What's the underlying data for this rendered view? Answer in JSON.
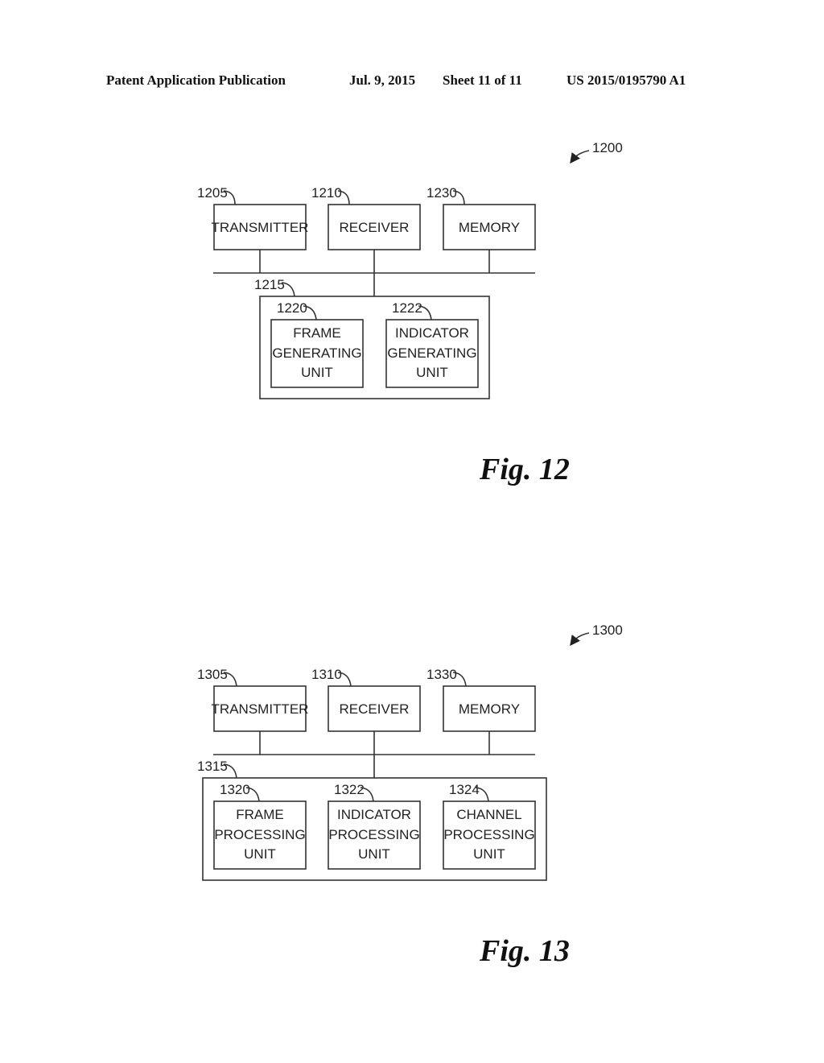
{
  "header": {
    "publication": "Patent Application Publication",
    "date": "Jul. 9, 2015",
    "sheet": "Sheet 11 of 11",
    "number": "US 2015/0195790 A1"
  },
  "fig12": {
    "ref": "1200",
    "caption": "Fig. 12",
    "bus_ref": "1215",
    "top_blocks": [
      {
        "ref": "1205",
        "label": "TRANSMITTER"
      },
      {
        "ref": "1210",
        "label": "RECEIVER"
      },
      {
        "ref": "1230",
        "label": "MEMORY"
      }
    ],
    "inner_blocks": [
      {
        "ref": "1220",
        "lines": [
          "FRAME",
          "GENERATING",
          "UNIT"
        ]
      },
      {
        "ref": "1222",
        "lines": [
          "INDICATOR",
          "GENERATING",
          "UNIT"
        ]
      }
    ]
  },
  "fig13": {
    "ref": "1300",
    "caption": "Fig. 13",
    "bus_ref": "1315",
    "top_blocks": [
      {
        "ref": "1305",
        "label": "TRANSMITTER"
      },
      {
        "ref": "1310",
        "label": "RECEIVER"
      },
      {
        "ref": "1330",
        "label": "MEMORY"
      }
    ],
    "inner_blocks": [
      {
        "ref": "1320",
        "lines": [
          "FRAME",
          "PROCESSING",
          "UNIT"
        ]
      },
      {
        "ref": "1322",
        "lines": [
          "INDICATOR",
          "PROCESSING",
          "UNIT"
        ]
      },
      {
        "ref": "1324",
        "lines": [
          "CHANNEL",
          "PROCESSING",
          "UNIT"
        ]
      }
    ]
  }
}
